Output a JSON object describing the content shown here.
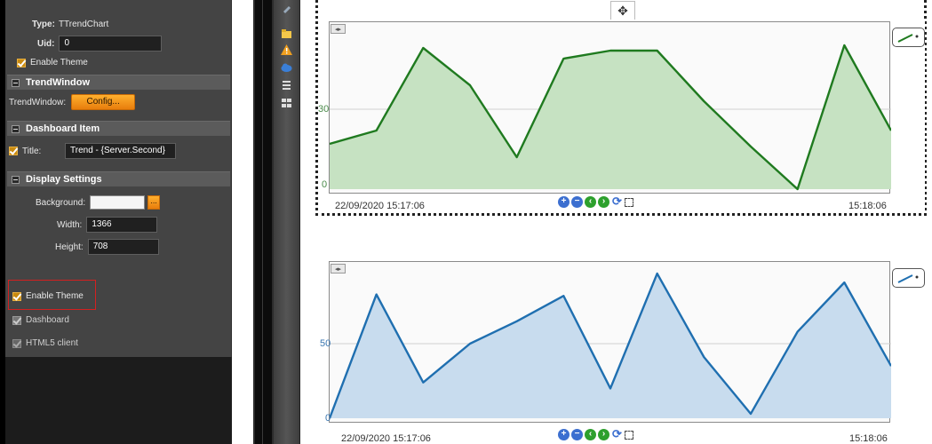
{
  "properties": {
    "type_label": "Type:",
    "type_value": "TTrendChart",
    "uid_label": "Uid:",
    "uid_value": "0",
    "enable_theme_top": "Enable Theme",
    "sections": {
      "trend_window": "TrendWindow",
      "dashboard_item": "Dashboard Item",
      "display_settings": "Display Settings"
    },
    "trend_window_label": "TrendWindow:",
    "config_button": "Config...",
    "title_label": "Title:",
    "title_value": "Trend - {Server.Second}",
    "background_label": "Background:",
    "ellipsis_button": "...",
    "width_label": "Width:",
    "width_value": "1366",
    "height_label": "Height:",
    "height_value": "708",
    "enable_theme": "Enable Theme",
    "dashboard": "Dashboard",
    "html5_client": "HTML5 client"
  },
  "colors": {
    "green_line": "#1f7a1f",
    "green_fill": "#c6e2c2",
    "blue_line": "#1f6fb0",
    "blue_fill": "#c8dcee",
    "highlight_red": "#d42020",
    "accent_orange": "#f0951e"
  },
  "chart_data": [
    {
      "type": "area",
      "x_start_label": "22/09/2020 15:17:06",
      "x_end_label": "15:18:06",
      "y_ticks": [
        "30",
        "0"
      ],
      "ylim": [
        0,
        60
      ],
      "values": [
        17,
        22,
        53,
        39,
        12,
        49,
        52,
        52,
        33,
        16,
        0,
        54,
        22
      ],
      "series_color": "#1f7a1f",
      "grid": "horizontal at 30"
    },
    {
      "type": "area",
      "x_start_label": "22/09/2020 15:17:06",
      "x_end_label": "15:18:06",
      "y_ticks": [
        "50",
        "0"
      ],
      "ylim": [
        0,
        100
      ],
      "values": [
        0,
        83,
        24,
        50,
        65,
        82,
        20,
        97,
        41,
        3,
        58,
        91,
        35
      ],
      "series_color": "#1f6fb0",
      "grid": "horizontal at 50"
    }
  ]
}
